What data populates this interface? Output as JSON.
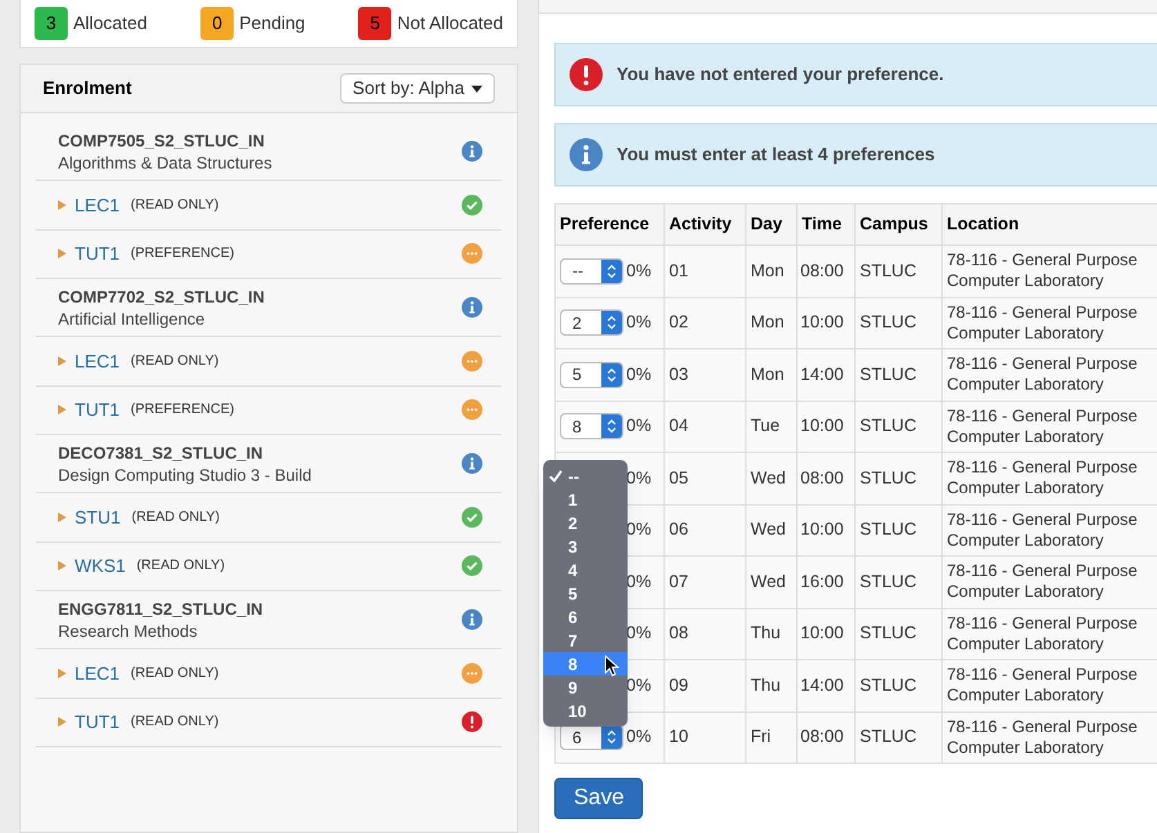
{
  "summary": [
    {
      "count": "3",
      "label": "Allocated",
      "color": "#2db94d"
    },
    {
      "count": "0",
      "label": "Pending",
      "color": "#f5a623"
    },
    {
      "count": "5",
      "label": "Not Allocated",
      "color": "#e0201b"
    }
  ],
  "enrolment": {
    "title": "Enrolment",
    "sort": "Sort by: Alpha",
    "courses": [
      {
        "code": "COMP7505_S2_STLUC_IN",
        "name": "Algorithms & Data Structures",
        "activities": [
          {
            "label": "LEC1",
            "mode": "(READ ONLY)",
            "kind": "allocated"
          },
          {
            "label": "TUT1",
            "mode": "(PREFERENCE)",
            "kind": "pending"
          }
        ]
      },
      {
        "code": "COMP7702_S2_STLUC_IN",
        "name": "Artificial Intelligence",
        "activities": [
          {
            "label": "LEC1",
            "mode": "(READ ONLY)",
            "kind": "pending"
          },
          {
            "label": "TUT1",
            "mode": "(PREFERENCE)",
            "kind": "pending"
          }
        ]
      },
      {
        "code": "DECO7381_S2_STLUC_IN",
        "name": "Design Computing Studio 3 - Build",
        "activities": [
          {
            "label": "STU1",
            "mode": "(READ ONLY)",
            "kind": "allocated"
          },
          {
            "label": "WKS1",
            "mode": "(READ ONLY)",
            "kind": "allocated"
          }
        ]
      },
      {
        "code": "ENGG7811_S2_STLUC_IN",
        "name": "Research Methods",
        "activities": [
          {
            "label": "LEC1",
            "mode": "(READ ONLY)",
            "kind": "pending"
          },
          {
            "label": "TUT1",
            "mode": "(READ ONLY)",
            "kind": "not_allocated"
          }
        ]
      }
    ]
  },
  "alerts": [
    {
      "kind": "error",
      "text": "You have not entered your preference."
    },
    {
      "kind": "info",
      "text": "You must enter at least 4 preferences"
    }
  ],
  "table": {
    "columns": [
      "Preference",
      "Activity",
      "Day",
      "Time",
      "Campus",
      "Location"
    ],
    "rows": [
      {
        "preference": "--",
        "percent": "0%",
        "activity": "01",
        "day": "Mon",
        "time": "08:00",
        "campus": "STLUC",
        "location": "78-116 - General Purpose Computer Laboratory"
      },
      {
        "preference": "2",
        "percent": "0%",
        "activity": "02",
        "day": "Mon",
        "time": "10:00",
        "campus": "STLUC",
        "location": "78-116 - General Purpose Computer Laboratory"
      },
      {
        "preference": "5",
        "percent": "0%",
        "activity": "03",
        "day": "Mon",
        "time": "14:00",
        "campus": "STLUC",
        "location": "78-116 - General Purpose Computer Laboratory"
      },
      {
        "preference": "8",
        "percent": "0%",
        "activity": "04",
        "day": "Tue",
        "time": "10:00",
        "campus": "STLUC",
        "location": "78-116 - General Purpose Computer Laboratory"
      },
      {
        "percent": "0%",
        "activity": "05",
        "day": "Wed",
        "time": "08:00",
        "campus": "STLUC",
        "location": "78-116 - General Purpose Computer Laboratory"
      },
      {
        "percent": "0%",
        "activity": "06",
        "day": "Wed",
        "time": "10:00",
        "campus": "STLUC",
        "location": "78-116 - General Purpose Computer Laboratory"
      },
      {
        "percent": "0%",
        "activity": "07",
        "day": "Wed",
        "time": "16:00",
        "campus": "STLUC",
        "location": "78-116 - General Purpose Computer Laboratory"
      },
      {
        "percent": "0%",
        "activity": "08",
        "day": "Thu",
        "time": "10:00",
        "campus": "STLUC",
        "location": "78-116 - General Purpose Computer Laboratory"
      },
      {
        "percent": "0%",
        "activity": "09",
        "day": "Thu",
        "time": "14:00",
        "campus": "STLUC",
        "location": "78-116 - General Purpose Computer Laboratory"
      },
      {
        "preference": "6",
        "percent": "0%",
        "activity": "10",
        "day": "Fri",
        "time": "08:00",
        "campus": "STLUC",
        "location": "78-116 - General Purpose Computer Laboratory"
      }
    ]
  },
  "dropdown": {
    "options": [
      {
        "label": "--",
        "selected": true,
        "highlighted": false
      },
      {
        "label": "1",
        "selected": false,
        "highlighted": false
      },
      {
        "label": "2",
        "selected": false,
        "highlighted": false
      },
      {
        "label": "3",
        "selected": false,
        "highlighted": false
      },
      {
        "label": "4",
        "selected": false,
        "highlighted": false
      },
      {
        "label": "5",
        "selected": false,
        "highlighted": false
      },
      {
        "label": "6",
        "selected": false,
        "highlighted": false
      },
      {
        "label": "7",
        "selected": false,
        "highlighted": false
      },
      {
        "label": "8",
        "selected": false,
        "highlighted": true
      },
      {
        "label": "9",
        "selected": false,
        "highlighted": false
      },
      {
        "label": "10",
        "selected": false,
        "highlighted": false
      }
    ]
  },
  "save": "Save"
}
